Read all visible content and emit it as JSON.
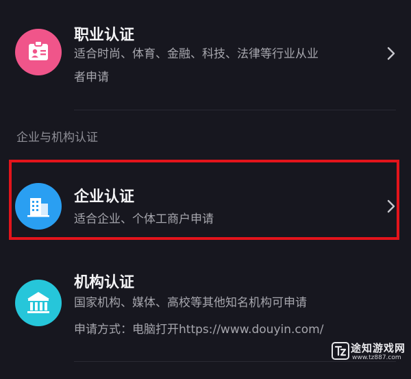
{
  "colors": {
    "background": "#17171f",
    "accent_pink": "#f0558a",
    "accent_blue": "#2a9ff2",
    "accent_teal": "#26c6da",
    "highlight": "#e3141b"
  },
  "professional": {
    "icon": "id-card-icon",
    "title": "职业认证",
    "desc_line1": "适合时尚、体育、金融、科技、法律等行业从业",
    "desc_line2": "者申请"
  },
  "section": {
    "header": "企业与机构认证"
  },
  "enterprise": {
    "icon": "building-icon",
    "title": "企业认证",
    "desc": "适合企业、个体工商户申请"
  },
  "institution": {
    "icon": "institution-icon",
    "title": "机构认证",
    "desc_line1": "国家机构、媒体、高校等其他知名机构可申请",
    "desc_line2": "申请方式：电脑打开https://www.douyin.com/"
  },
  "watermark": {
    "name": "途知游戏网",
    "url": "www.tz887.com"
  }
}
